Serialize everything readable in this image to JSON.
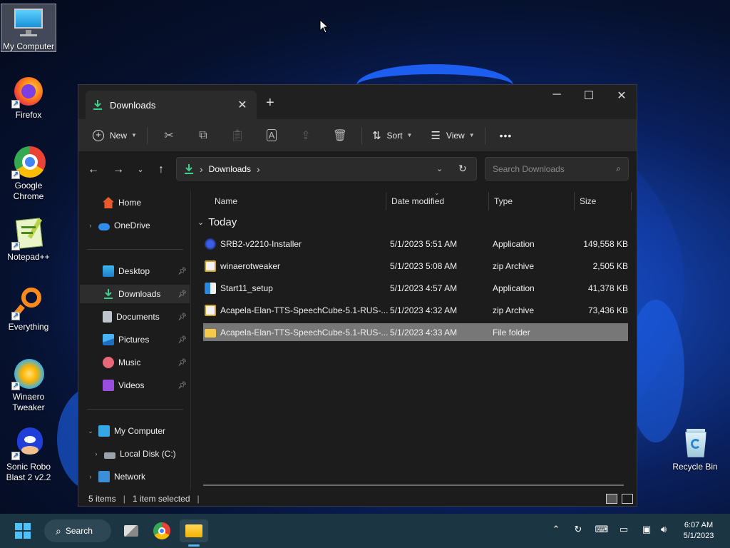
{
  "desktop": {
    "icons": [
      {
        "label": "My Computer",
        "icon": "monitor-icon"
      },
      {
        "label": "Firefox",
        "icon": "firefox-icon"
      },
      {
        "label": "Google Chrome",
        "icon": "chrome-icon"
      },
      {
        "label": "Notepad++",
        "icon": "notepadpp-icon"
      },
      {
        "label": "Everything",
        "icon": "everything-search-icon"
      },
      {
        "label": "Winaero Tweaker",
        "icon": "winaero-tweaker-icon"
      },
      {
        "label": "Sonic Robo Blast 2 v2.2",
        "icon": "sonic-icon"
      },
      {
        "label": "Recycle Bin",
        "icon": "recycle-bin-icon"
      }
    ]
  },
  "explorer": {
    "tab_title": "Downloads",
    "new_tab": "+",
    "commands": {
      "new": "New",
      "sort": "Sort",
      "view": "View",
      "more": "•••"
    },
    "address": {
      "crumb": "Downloads",
      "separator": "›"
    },
    "search_placeholder": "Search Downloads",
    "sidebar": {
      "home": "Home",
      "onedrive": "OneDrive",
      "desktop": "Desktop",
      "downloads": "Downloads",
      "documents": "Documents",
      "pictures": "Pictures",
      "music": "Music",
      "videos": "Videos",
      "my_computer": "My Computer",
      "local_disk": "Local Disk (C:)",
      "network": "Network"
    },
    "columns": {
      "name": "Name",
      "date": "Date modified",
      "type": "Type",
      "size": "Size"
    },
    "group": "Today",
    "files": [
      {
        "name": "SRB2-v2210-Installer",
        "date": "5/1/2023 5:51 AM",
        "type": "Application",
        "size": "149,558 KB",
        "icon": "installer-icon",
        "selected": false
      },
      {
        "name": "winaerotweaker",
        "date": "5/1/2023 5:08 AM",
        "type": "zip Archive",
        "size": "2,505 KB",
        "icon": "zip-icon",
        "selected": false
      },
      {
        "name": "Start11_setup",
        "date": "5/1/2023 4:57 AM",
        "type": "Application",
        "size": "41,378 KB",
        "icon": "setup-icon",
        "selected": false
      },
      {
        "name": "Acapela-Elan-TTS-SpeechCube-5.1-RUS-...",
        "date": "5/1/2023 4:32 AM",
        "type": "zip Archive",
        "size": "73,436 KB",
        "icon": "zip-icon",
        "selected": false
      },
      {
        "name": "Acapela-Elan-TTS-SpeechCube-5.1-RUS-...",
        "date": "5/1/2023 4:33 AM",
        "type": "File folder",
        "size": "",
        "icon": "folder-icon",
        "selected": true
      }
    ],
    "status": {
      "items": "5 items",
      "selected": "1 item selected"
    }
  },
  "taskbar": {
    "search_label": "Search",
    "time": "6:07 AM",
    "date": "5/1/2023"
  }
}
